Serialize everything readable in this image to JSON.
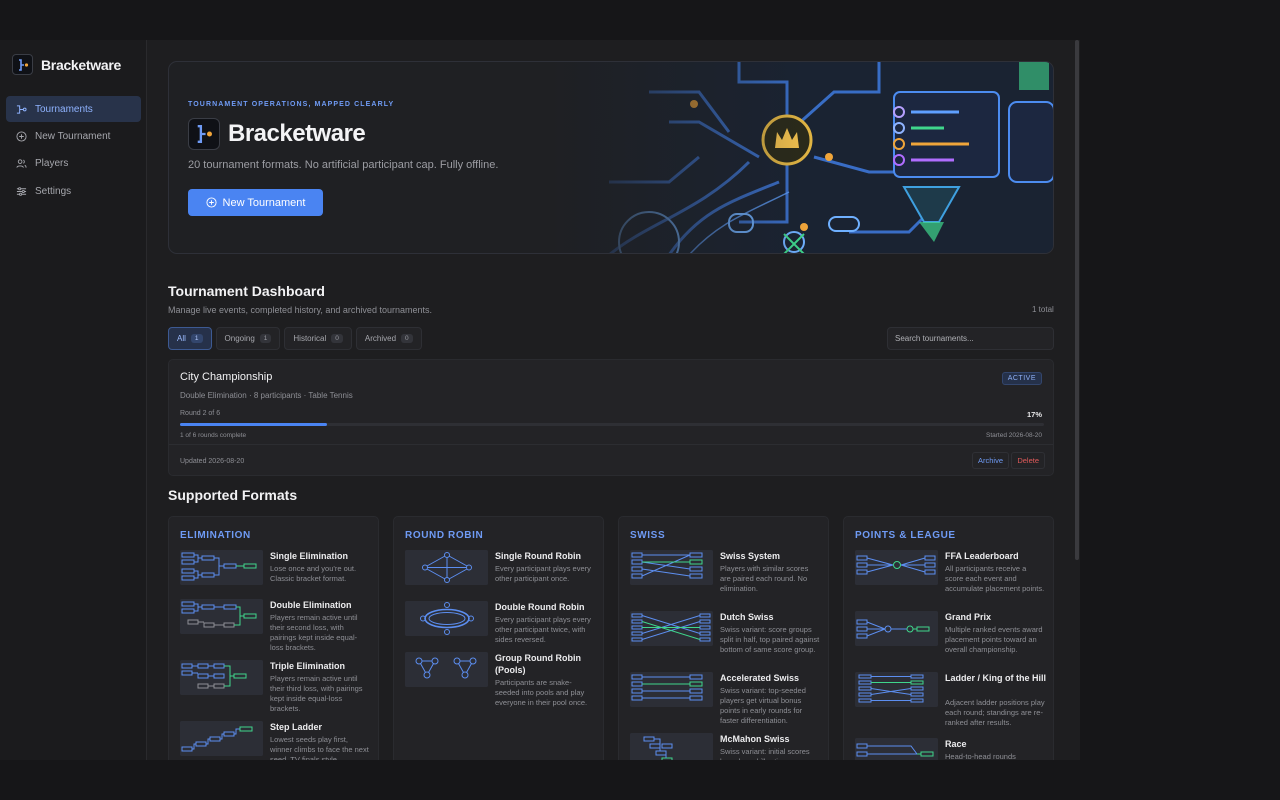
{
  "app": {
    "name": "Bracketware"
  },
  "sidebar": {
    "items": [
      {
        "label": "Tournaments",
        "icon": "bracket-icon",
        "active": true
      },
      {
        "label": "New Tournament",
        "icon": "plus-circle-icon",
        "active": false
      },
      {
        "label": "Players",
        "icon": "users-icon",
        "active": false
      },
      {
        "label": "Settings",
        "icon": "sliders-icon",
        "active": false
      }
    ]
  },
  "hero": {
    "eyebrow": "TOURNAMENT OPERATIONS, MAPPED CLEARLY",
    "title": "Bracketware",
    "subtitle": "20 tournament formats. No artificial participant cap. Fully offline.",
    "button_label": "New Tournament"
  },
  "dashboard": {
    "title": "Tournament Dashboard",
    "subtitle": "Manage live events, completed history, and archived tournaments.",
    "total": "1 total",
    "tabs": [
      {
        "label": "All",
        "count": "1",
        "active": true
      },
      {
        "label": "Ongoing",
        "count": "1",
        "active": false
      },
      {
        "label": "Historical",
        "count": "0",
        "active": false
      },
      {
        "label": "Archived",
        "count": "0",
        "active": false
      }
    ],
    "search_placeholder": "Search tournaments..."
  },
  "tournament": {
    "name": "City Championship",
    "format": "Double Elimination",
    "participants": "8 participants",
    "sport": "Table Tennis",
    "status": "ACTIVE",
    "round": "Round 2 of 6",
    "percent": "17%",
    "progress": 0.17,
    "rounds_complete": "1 of 6 rounds complete",
    "started": "Started 2026-08-20",
    "updated": "Updated 2026-08-20",
    "archive_label": "Archive",
    "delete_label": "Delete"
  },
  "formats": {
    "title": "Supported Formats",
    "columns": [
      {
        "title": "ELIMINATION",
        "items": [
          {
            "name": "Single Elimination",
            "desc": "Lose once and you're out. Classic bracket format."
          },
          {
            "name": "Double Elimination",
            "desc": "Players remain active until their second loss, with pairings kept inside equal-loss brackets."
          },
          {
            "name": "Triple Elimination",
            "desc": "Players remain active until their third loss, with pairings kept inside equal-loss brackets."
          },
          {
            "name": "Step Ladder",
            "desc": "Lowest seeds play first, winner climbs to face the next seed. TV finals style."
          }
        ]
      },
      {
        "title": "ROUND ROBIN",
        "items": [
          {
            "name": "Single Round Robin",
            "desc": "Every participant plays every other participant once."
          },
          {
            "name": "Double Round Robin",
            "desc": "Every participant plays every other participant twice, with sides reversed."
          },
          {
            "name": "Group Round Robin (Pools)",
            "desc": "Participants are snake-seeded into pools and play everyone in their pool once."
          }
        ]
      },
      {
        "title": "SWISS",
        "items": [
          {
            "name": "Swiss System",
            "desc": "Players with similar scores are paired each round. No elimination."
          },
          {
            "name": "Dutch Swiss",
            "desc": "Swiss variant: score groups split in half, top paired against bottom of same score group."
          },
          {
            "name": "Accelerated Swiss",
            "desc": "Swiss variant: top-seeded players get virtual bonus points in early rounds for faster differentiation."
          },
          {
            "name": "McMahon Swiss",
            "desc": "Swiss variant: initial scores based on skill rating."
          }
        ]
      },
      {
        "title": "POINTS & LEAGUE",
        "items": [
          {
            "name": "FFA Leaderboard",
            "desc": "All participants receive a score each event and accumulate placement points."
          },
          {
            "name": "Grand Prix",
            "desc": "Multiple ranked events award placement points toward an overall championship."
          },
          {
            "name": "Ladder / King of the Hill",
            "desc": "Adjacent ladder positions play each round; standings are re-ranked after results."
          },
          {
            "name": "Race",
            "desc": "Head-to-head rounds"
          }
        ]
      }
    ]
  },
  "colors": {
    "accent": "#4a84f2",
    "accent_text": "#6f9bf5",
    "danger": "#e05a5a",
    "green": "#3fd68c"
  }
}
